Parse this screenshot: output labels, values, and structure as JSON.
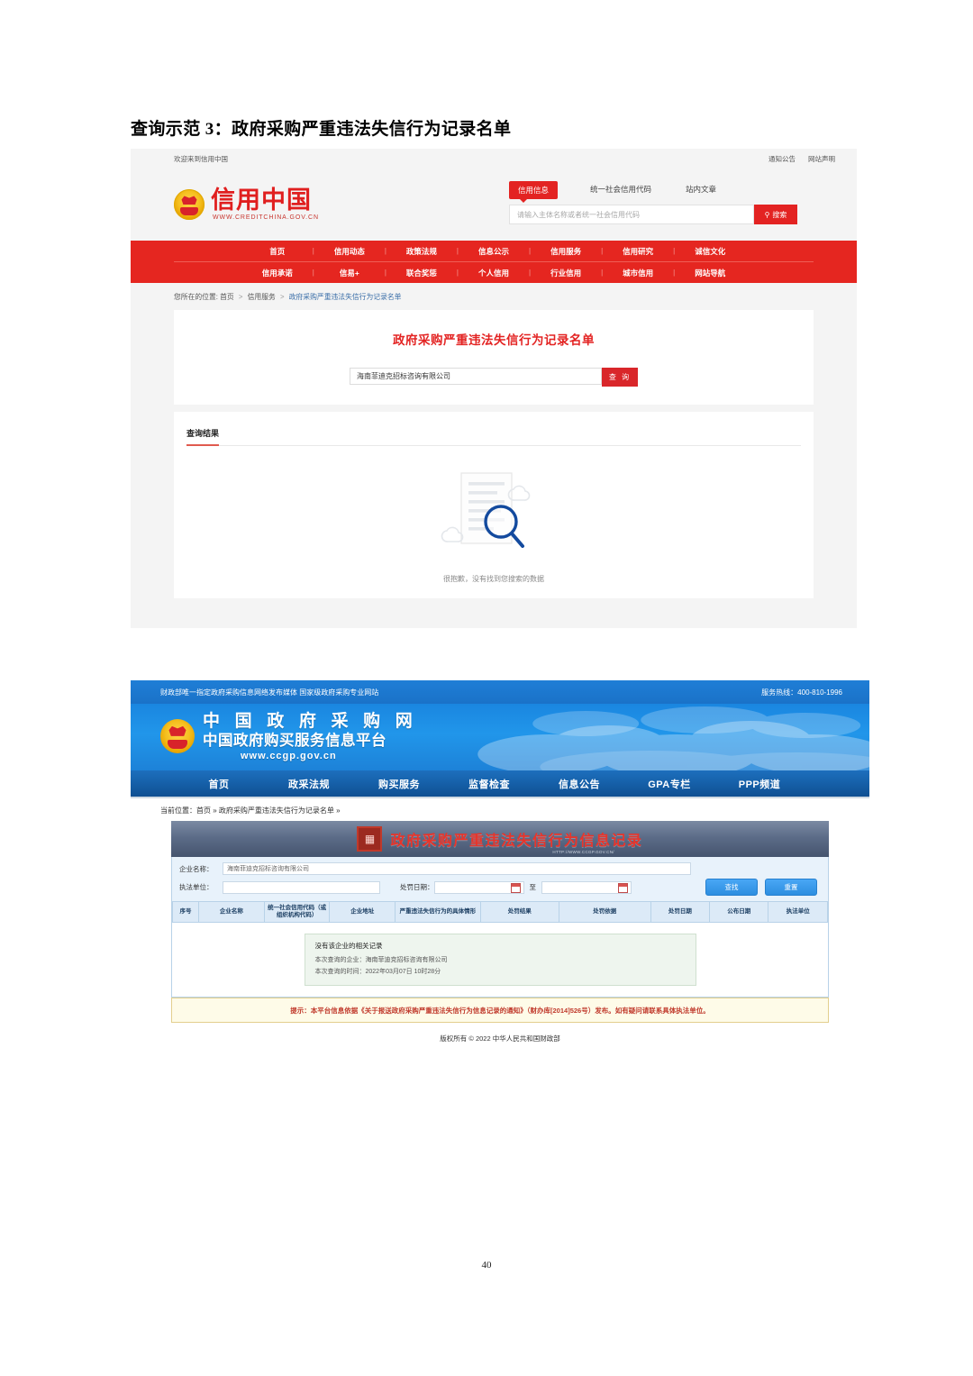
{
  "document": {
    "heading": "查询示范 3：政府采购严重违法失信行为记录名单",
    "page_number": "40"
  },
  "creditchina": {
    "topbar": {
      "welcome": "欢迎来到信用中国",
      "links": [
        "通知公告",
        "网站声明"
      ]
    },
    "logo": {
      "name": "信用中国",
      "url": "WWW.CREDITCHINA.GOV.CN",
      "emblem_icon": "national-emblem-icon"
    },
    "search": {
      "tabs": [
        "信用信息",
        "统一社会信用代码",
        "站内文章"
      ],
      "active_tab": "信用信息",
      "placeholder": "请输入主体名称或者统一社会信用代码",
      "value": "",
      "button_label": "搜索",
      "button_icon": "search-icon"
    },
    "nav_row1": [
      "首页",
      "信用动态",
      "政策法规",
      "信息公示",
      "信用服务",
      "信用研究",
      "诚信文化"
    ],
    "nav_row2": [
      "信用承诺",
      "信易+",
      "联合奖惩",
      "个人信用",
      "行业信用",
      "城市信用",
      "网站导航"
    ],
    "breadcrumb": {
      "prefix": "您所在的位置:",
      "items": [
        "首页",
        "信用服务",
        "政府采购严重违法失信行为记录名单"
      ],
      "separator": "＞"
    },
    "card": {
      "title": "政府采购严重违法失信行为记录名单",
      "query_value": "海南菲迪克招标咨询有限公司",
      "query_button": "查 询"
    },
    "result": {
      "heading": "查询结果",
      "empty_text": "很抱歉，没有找到您搜索的数据",
      "empty_icon": "document-magnifier-icon"
    },
    "colors": {
      "brand_red": "#e32322",
      "nav_red": "#e52620",
      "page_bg": "#f4f4f4"
    }
  },
  "ccgp": {
    "topstrip": {
      "left": "财政部唯一指定政府采购信息网络发布媒体 国家级政府采购专业网站",
      "right": "服务热线：400-810-1996"
    },
    "banner": {
      "title_1": "中 国 政 府 采 购 网",
      "title_2": "中国政府购买服务信息平台",
      "url": "www.ccgp.gov.cn",
      "emblem_icon": "national-emblem-icon"
    },
    "nav": [
      "首页",
      "政采法规",
      "购买服务",
      "监督检查",
      "信息公告",
      "GPA专栏",
      "PPP频道"
    ],
    "breadcrumb": "当前位置：首页 » 政府采购严重违法失信行为记录名单 »",
    "titlebar": {
      "text": "政府采购严重违法失信行为信息记录",
      "url": "HTTP://WWW.CCGP.GOV.CN/",
      "icon": "seal-icon"
    },
    "form": {
      "company_label": "企业名称：",
      "company_value": "海南菲迪克招标咨询有限公司",
      "agency_label": "执法单位：",
      "agency_value": "",
      "penalty_date_label": "处罚日期：",
      "date_from": "",
      "date_to": "",
      "date_separator": "至",
      "calendar_icon": "calendar-icon",
      "search_button": "查找",
      "reset_button": "重置"
    },
    "table_headers": [
      "序号",
      "企业名称",
      "统一社会信用代码（或组织机构代码）",
      "企业地址",
      "严重违法失信行为的具体情形",
      "处罚结果",
      "处罚依据",
      "处罚日期",
      "公布日期",
      "执法单位"
    ],
    "message": {
      "title": "没有该企业的相关记录",
      "line_1": "本次查询的企业：海南菲迪克招标咨询有限公司",
      "line_2": "本次查询的时间：2022年03月07日 10时28分"
    },
    "notice": "提示：本平台信息依据《关于报送政府采购严重违法失信行为信息记录的通知》（财办库[2014]526号）发布。如有疑问请联系具体执法单位。",
    "copyright": "版权所有 © 2022 中华人民共和国财政部",
    "colors": {
      "banner_blue": "#1a86e0",
      "nav_blue": "#155ea6",
      "title_red": "#e8342a",
      "notice_bg": "#fefbe8"
    }
  }
}
